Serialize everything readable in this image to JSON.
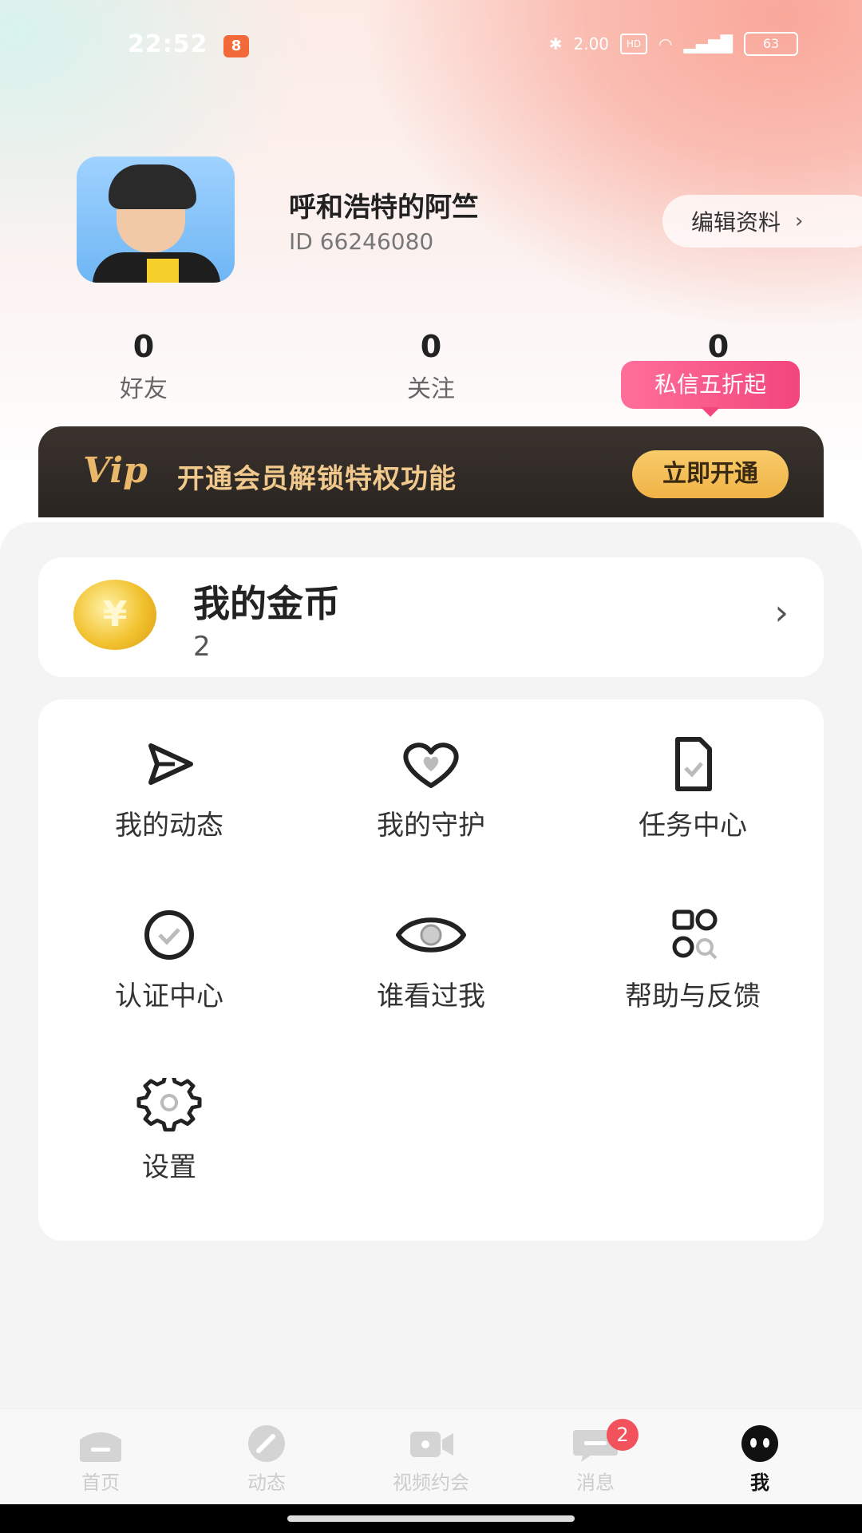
{
  "status_bar": {
    "time": "22:52",
    "app_badge": "8",
    "network_speed": "2.00",
    "hd": "HD",
    "battery": "63"
  },
  "profile": {
    "nickname": "呼和浩特的阿竺",
    "id_text": "ID 66246080",
    "edit_label": "编辑资料",
    "edit_chevron": "›"
  },
  "stats": [
    {
      "value": "0",
      "label": "好友"
    },
    {
      "value": "0",
      "label": "关注"
    },
    {
      "value": "0",
      "label": ""
    }
  ],
  "promo_tag": "私信五折起",
  "vip": {
    "logo": "Vip",
    "text": "开通会员解锁特权功能",
    "cta": "立即开通"
  },
  "coins": {
    "title": "我的金币",
    "value": "2",
    "chevron": "›"
  },
  "menu": [
    {
      "label": "我的动态",
      "icon": "send-icon"
    },
    {
      "label": "我的守护",
      "icon": "heart-icon"
    },
    {
      "label": "任务中心",
      "icon": "document-check-icon"
    },
    {
      "label": "认证中心",
      "icon": "check-circle-icon"
    },
    {
      "label": "谁看过我",
      "icon": "eye-icon"
    },
    {
      "label": "帮助与反馈",
      "icon": "apps-search-icon"
    },
    {
      "label": "设置",
      "icon": "gear-icon"
    }
  ],
  "nav": [
    {
      "label": "首页",
      "icon": "home-icon"
    },
    {
      "label": "动态",
      "icon": "pencil-icon"
    },
    {
      "label": "视频约会",
      "icon": "video-icon"
    },
    {
      "label": "消息",
      "icon": "message-icon",
      "badge": "2"
    },
    {
      "label": "我",
      "icon": "profile-face-icon"
    }
  ],
  "colors": {
    "accent_pink": "#f2467c",
    "vip_gold": "#f0b347",
    "badge_red": "#f2525b"
  }
}
